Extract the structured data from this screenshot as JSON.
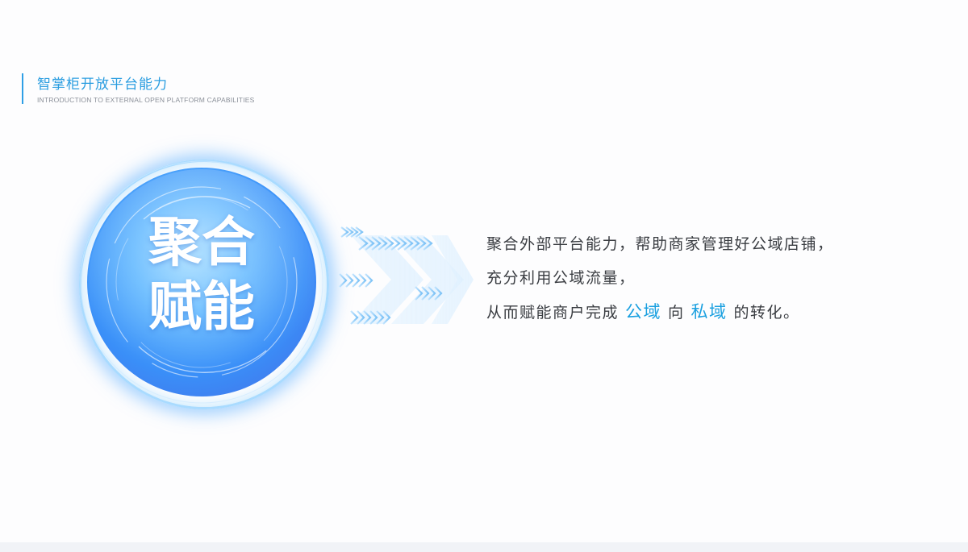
{
  "header": {
    "title": "智掌柜开放平台能力",
    "subtitle": "INTRODUCTION TO EXTERNAL OPEN PLATFORM CAPABILITIES",
    "accent_color": "#2a9de0"
  },
  "orb": {
    "line1": "聚合",
    "line2": "赋能"
  },
  "description": {
    "line1": "聚合外部平台能力，帮助商家管理好公域店铺，",
    "line2": "充分利用公域流量，",
    "line3_prefix": "从而赋能商户完成",
    "line3_highlight1": "公域",
    "line3_middle": "向",
    "line3_highlight2": "私域",
    "line3_suffix": "的转化。",
    "highlight_color": "#1aa0e0"
  },
  "icons": {
    "arrows": "chevron-arrows-icon",
    "orb": "glowing-orb-icon"
  }
}
